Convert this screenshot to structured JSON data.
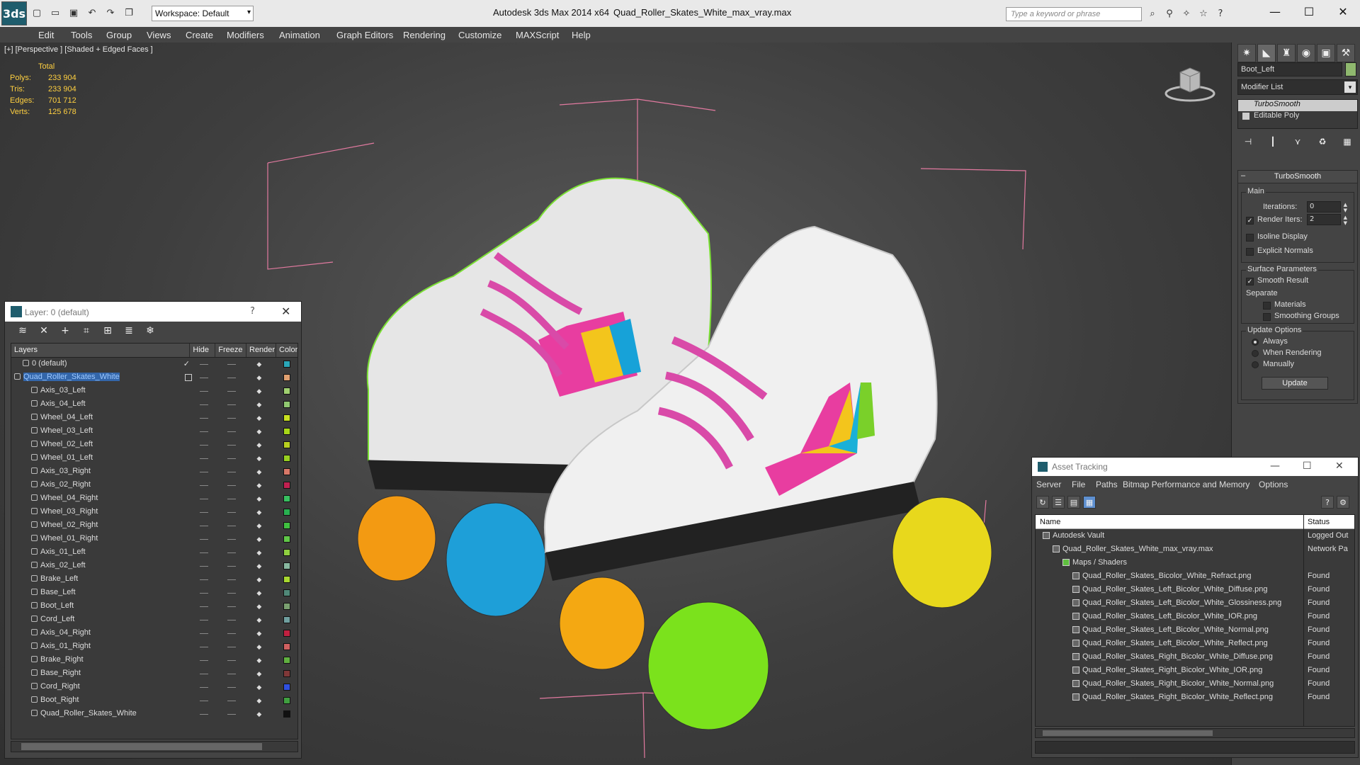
{
  "title_bar": {
    "logo": "3ds",
    "workspace": "Workspace: Default",
    "app_title": "Autodesk 3ds Max  2014 x64",
    "file_title": "Quad_Roller_Skates_White_max_vray.max",
    "search_placeholder": "Type a keyword or phrase",
    "quick_access_icons": [
      "new-file-icon",
      "open-icon",
      "save-icon",
      "undo-icon",
      "redo-icon",
      "project-icon"
    ],
    "search_tool_icons": [
      "binoculars-icon",
      "communication-icon",
      "favorites-icon",
      "star-icon",
      "help-icon"
    ]
  },
  "menu": {
    "items": [
      "Edit",
      "Tools",
      "Group",
      "Views",
      "Create",
      "Modifiers",
      "Animation",
      "Graph Editors",
      "Rendering",
      "Customize",
      "MAXScript",
      "Help"
    ]
  },
  "viewport": {
    "label": "[+] [Perspective ] [Shaded + Edged Faces ]",
    "stats": {
      "header": "Total",
      "rows": [
        {
          "label": "Polys:",
          "value": "233 904"
        },
        {
          "label": "Tris:",
          "value": "233 904"
        },
        {
          "label": "Edges:",
          "value": "701 712"
        },
        {
          "label": "Verts:",
          "value": "125 678"
        }
      ]
    }
  },
  "command_panel": {
    "object_name": "Boot_Left",
    "object_color": "#8fb86e",
    "modifier_list": "Modifier List",
    "stack": [
      {
        "label": "TurboSmooth",
        "selected": true
      },
      {
        "label": "Editable Poly",
        "selected": false
      }
    ],
    "rollout_title": "TurboSmooth",
    "main_group": "Main",
    "iterations_label": "Iterations:",
    "iterations_value": "0",
    "render_iters_label": "Render Iters:",
    "render_iters_value": "2",
    "isoline": "Isoline Display",
    "explicit": "Explicit Normals",
    "surface_group": "Surface Parameters",
    "smooth_result": "Smooth Result",
    "separate": "Separate",
    "materials": "Materials",
    "smoothing_groups": "Smoothing Groups",
    "update_group": "Update Options",
    "always": "Always",
    "when_rendering": "When Rendering",
    "manually": "Manually",
    "update_button": "Update"
  },
  "layer_window": {
    "title": "Layer: 0 (default)",
    "help": "?",
    "close": "✕",
    "columns": [
      "Layers",
      "Hide",
      "Freeze",
      "Render",
      "Color"
    ],
    "rows": [
      {
        "name": "0 (default)",
        "indent": 1,
        "color": "#2aa6b8",
        "check": true
      },
      {
        "name": "Quad_Roller_Skates_White",
        "indent": 0,
        "color": "#e0a070",
        "selected": true
      },
      {
        "name": "Axis_03_Left",
        "indent": 2,
        "color": "#a0d070"
      },
      {
        "name": "Axis_04_Left",
        "indent": 2,
        "color": "#90c870"
      },
      {
        "name": "Wheel_04_Left",
        "indent": 2,
        "color": "#c8e020"
      },
      {
        "name": "Wheel_03_Left",
        "indent": 2,
        "color": "#a8d818"
      },
      {
        "name": "Wheel_02_Left",
        "indent": 2,
        "color": "#b8d020"
      },
      {
        "name": "Wheel_01_Left",
        "indent": 2,
        "color": "#98d020"
      },
      {
        "name": "Axis_03_Right",
        "indent": 2,
        "color": "#d87868"
      },
      {
        "name": "Axis_02_Right",
        "indent": 2,
        "color": "#c02050"
      },
      {
        "name": "Wheel_04_Right",
        "indent": 2,
        "color": "#38c060"
      },
      {
        "name": "Wheel_03_Right",
        "indent": 2,
        "color": "#28b050"
      },
      {
        "name": "Wheel_02_Right",
        "indent": 2,
        "color": "#40c040"
      },
      {
        "name": "Wheel_01_Right",
        "indent": 2,
        "color": "#60c848"
      },
      {
        "name": "Axis_01_Left",
        "indent": 2,
        "color": "#90d040"
      },
      {
        "name": "Axis_02_Left",
        "indent": 2,
        "color": "#88b8a0"
      },
      {
        "name": "Brake_Left",
        "indent": 2,
        "color": "#a8d830"
      },
      {
        "name": "Base_Left",
        "indent": 2,
        "color": "#508878"
      },
      {
        "name": "Boot_Left",
        "indent": 2,
        "color": "#7aa070"
      },
      {
        "name": "Cord_Left",
        "indent": 2,
        "color": "#70a0a0"
      },
      {
        "name": "Axis_04_Right",
        "indent": 2,
        "color": "#c02040"
      },
      {
        "name": "Axis_01_Right",
        "indent": 2,
        "color": "#d06060"
      },
      {
        "name": "Brake_Right",
        "indent": 2,
        "color": "#60b040"
      },
      {
        "name": "Base_Right",
        "indent": 2,
        "color": "#803838"
      },
      {
        "name": "Cord_Right",
        "indent": 2,
        "color": "#3050e0"
      },
      {
        "name": "Boot_Right",
        "indent": 2,
        "color": "#40a040"
      },
      {
        "name": "Quad_Roller_Skates_White",
        "indent": 2,
        "color": "#111111"
      }
    ]
  },
  "asset_window": {
    "title": "Asset Tracking",
    "menu": [
      "Server",
      "File",
      "Paths",
      "Bitmap Performance and Memory",
      "Options"
    ],
    "columns": [
      "Name",
      "Status"
    ],
    "rows": [
      {
        "name": "Autodesk Vault",
        "status": "Logged Out",
        "indent": 0
      },
      {
        "name": "Quad_Roller_Skates_White_max_vray.max",
        "status": "Network Pa",
        "indent": 1
      },
      {
        "name": "Maps / Shaders",
        "status": "",
        "indent": 2
      },
      {
        "name": "Quad_Roller_Skates_Bicolor_White_Refract.png",
        "status": "Found",
        "indent": 3
      },
      {
        "name": "Quad_Roller_Skates_Left_Bicolor_White_Diffuse.png",
        "status": "Found",
        "indent": 3
      },
      {
        "name": "Quad_Roller_Skates_Left_Bicolor_White_Glossiness.png",
        "status": "Found",
        "indent": 3
      },
      {
        "name": "Quad_Roller_Skates_Left_Bicolor_White_IOR.png",
        "status": "Found",
        "indent": 3
      },
      {
        "name": "Quad_Roller_Skates_Left_Bicolor_White_Normal.png",
        "status": "Found",
        "indent": 3
      },
      {
        "name": "Quad_Roller_Skates_Left_Bicolor_White_Reflect.png",
        "status": "Found",
        "indent": 3
      },
      {
        "name": "Quad_Roller_Skates_Right_Bicolor_White_Diffuse.png",
        "status": "Found",
        "indent": 3
      },
      {
        "name": "Quad_Roller_Skates_Right_Bicolor_White_IOR.png",
        "status": "Found",
        "indent": 3
      },
      {
        "name": "Quad_Roller_Skates_Right_Bicolor_White_Normal.png",
        "status": "Found",
        "indent": 3
      },
      {
        "name": "Quad_Roller_Skates_Right_Bicolor_White_Reflect.png",
        "status": "Found",
        "indent": 3
      }
    ]
  }
}
